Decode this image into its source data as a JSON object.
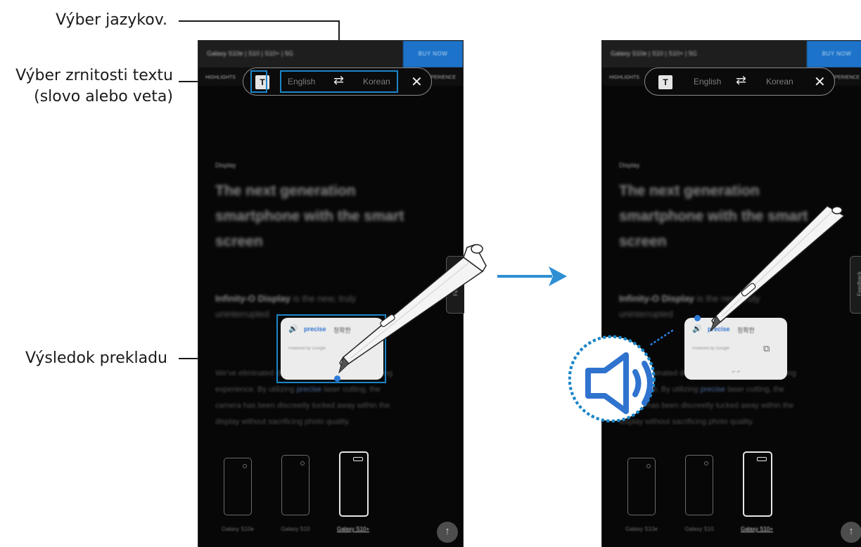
{
  "callouts": {
    "language": "Výber jazykov.",
    "granularity_line1": "Výber zrnitosti textu",
    "granularity_line2": "(slovo alebo veta)",
    "result": "Výsledok prekladu"
  },
  "screen": {
    "url": "Galaxy S10e | S10 | S10+ | 5G",
    "buy_now": "BUY NOW",
    "subnav_left": "HIGHLIGHTS",
    "subnav_right": "EXPERIENCE",
    "section": "Display",
    "headline": [
      "The next generation",
      "smartphone with the smart",
      "screen"
    ],
    "infinity_bold": "Infinity-O Display",
    "infinity_rest": " is the new, truly",
    "infinity_line2": "uninterrupted",
    "body": [
      "We've eliminated distractions for a dramatic viewing",
      "experience. By utilizing ",
      " laser cutting, the",
      "camera has been discreetly tucked away within the",
      "display without sacrificing photo quality."
    ],
    "body_highlight": "precise",
    "devices": [
      "Galaxy S10e",
      "Galaxy S10",
      "Galaxy S10+"
    ],
    "feedback": "Feedback",
    "scroll_top": "↑"
  },
  "toolbar": {
    "granularity_icon": "T",
    "source_language": "English",
    "swap_icon": "⇄",
    "target_language": "Korean",
    "close_icon": "✕"
  },
  "translation": {
    "speaker_icon": "🔊",
    "word": "precise",
    "translated": "정확한",
    "powered_by": "Powered by Google",
    "copy_icon": "⧉",
    "handles": "⌐ ⌐"
  },
  "colors": {
    "highlight": "#1b86c9",
    "arrow": "#2f8fd4",
    "buy_now": "#1c73c9",
    "speaker": "#2b7bd8"
  }
}
